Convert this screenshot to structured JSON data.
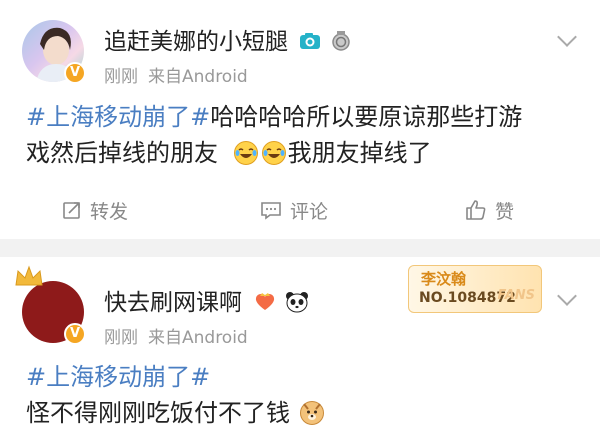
{
  "post1": {
    "username": "追赶美娜的小短腿",
    "time": "刚刚",
    "source": "来自Android",
    "hashtag": "#上海移动崩了#",
    "text_line1_rest": "哈哈哈哈所以要原谅那些打游",
    "text_line2": "戏然后掉线的朋友",
    "text_after_emoji": "我朋友掉线了",
    "actions": {
      "repost": "转发",
      "comment": "评论",
      "like": "赞"
    },
    "icons": [
      "camera-badge-icon",
      "medal-badge-icon",
      "vip-v-icon",
      "laugh-cry-emoji"
    ]
  },
  "post2": {
    "username": "快去刷网课啊",
    "time": "刚刚",
    "source": "来自Android",
    "hashtag": "#上海移动崩了#",
    "text": "怪不得刚刚吃饭付不了钱",
    "fans_badge": {
      "name": "李汶翰",
      "number": "NO.1084872",
      "label": "FANS"
    },
    "icons": [
      "crown-icon",
      "vip-heart-icon",
      "panda-icon",
      "vip-v-icon",
      "doge-emoji"
    ]
  },
  "colors": {
    "hashtag": "#4a7ec2",
    "meta": "#999999",
    "verified_badge": "#f5a623",
    "separator": "#f2f2f2"
  }
}
